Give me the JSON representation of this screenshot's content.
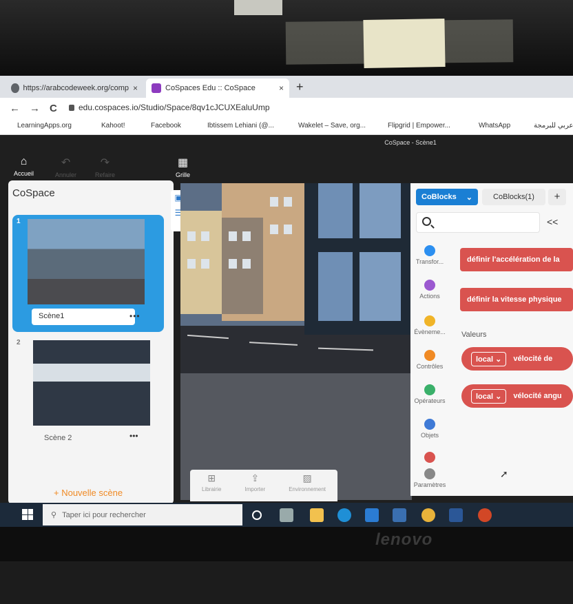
{
  "browser": {
    "tabs": [
      {
        "title": "https://arabcodeweek.org/comp",
        "close": "×"
      },
      {
        "title": "CoSpaces Edu :: CoSpace",
        "close": "×"
      }
    ],
    "new_tab": "+",
    "nav": {
      "back": "←",
      "forward": "→",
      "reload": "C"
    },
    "url": "edu.cospaces.io/Studio/Space/8qv1cJCUXEaluUmp",
    "bookmarks": [
      {
        "label": "LearningApps.org",
        "color": "#2f6db5"
      },
      {
        "label": "Kahoot!",
        "color": "#46178f"
      },
      {
        "label": "Facebook",
        "color": "#1877f2"
      },
      {
        "label": "Ibtissem Lehiani (@...",
        "color": "#1da1f2"
      },
      {
        "label": "Wakelet – Save, org...",
        "color": "#2a2ad8"
      },
      {
        "label": "Flipgrid | Empower...",
        "color": "#5ab031"
      },
      {
        "label": "WhatsApp",
        "color": "#25d366"
      },
      {
        "label": "عربي للبرمجة",
        "color": "#e8a33a"
      }
    ]
  },
  "app": {
    "window_title": "CoSpace - Scène1",
    "toolbar": [
      {
        "label": "Accueil",
        "icon": "home-icon",
        "enabled": true
      },
      {
        "label": "Annuler",
        "icon": "undo-icon",
        "enabled": false
      },
      {
        "label": "Refaire",
        "icon": "redo-icon",
        "enabled": false
      },
      {
        "label": "Grille",
        "icon": "grid-icon",
        "enabled": true
      }
    ],
    "scenes_panel": {
      "title": "CoSpace",
      "scenes": [
        {
          "number": "1",
          "name": "Scène1",
          "menu": "•••",
          "selected": true
        },
        {
          "number": "2",
          "name": "Scène 2",
          "menu": "•••",
          "selected": false
        }
      ],
      "new_scene": "+ Nouvelle scène"
    },
    "bottom_tools": [
      {
        "label": "Librairie",
        "icon": "library-icon"
      },
      {
        "label": "Importer",
        "icon": "upload-icon"
      },
      {
        "label": "Environnement",
        "icon": "environment-icon"
      }
    ],
    "coblocks": {
      "active_tab": "CoBlocks",
      "tab2": "CoBlocks(1)",
      "add": "+",
      "collapse": "<<",
      "categories": [
        {
          "label": "Transfor...",
          "color": "#2c8ff0"
        },
        {
          "label": "Actions",
          "color": "#9b59d0"
        },
        {
          "label": "Évèneme...",
          "color": "#f0b428"
        },
        {
          "label": "Contrôles",
          "color": "#f08a24"
        },
        {
          "label": "Opérateurs",
          "color": "#3ab06a"
        },
        {
          "label": "Objets",
          "color": "#3f7ad6"
        },
        {
          "label": "",
          "color": "#d9534f"
        },
        {
          "label": "Paramètres",
          "color": "#888888"
        }
      ],
      "blocks": [
        {
          "text": "définir l'accélération de la"
        },
        {
          "text": "définir la vitesse physique"
        }
      ],
      "section_label": "Valeurs",
      "value_blocks": [
        {
          "select": "local ⌄",
          "text": "vélocité de"
        },
        {
          "select": "local ⌄",
          "text": "vélocité angu"
        }
      ]
    }
  },
  "taskbar": {
    "search_placeholder": "Taper ici pour rechercher"
  },
  "laptop": {
    "brand": "lenovo"
  }
}
